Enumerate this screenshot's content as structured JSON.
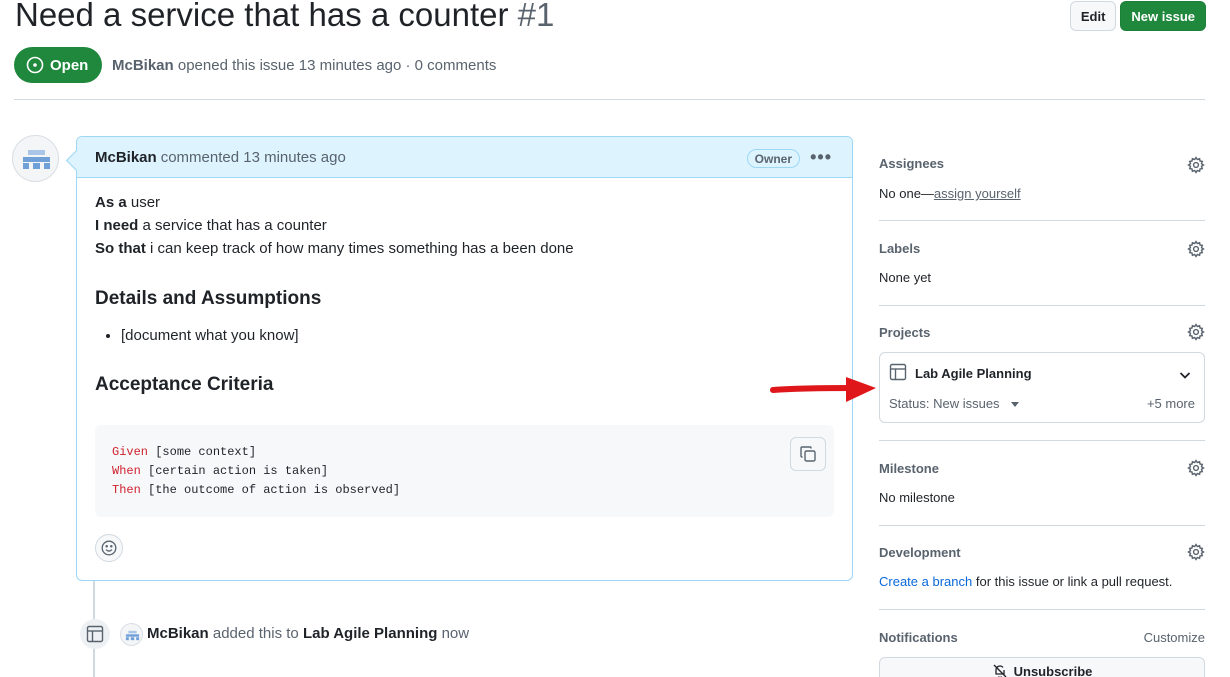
{
  "issue": {
    "title": "Need a service that has a counter",
    "number": "#1",
    "state": "Open",
    "author": "McBikan",
    "meta_rest": "opened this issue 13 minutes ago · 0 comments"
  },
  "header_buttons": {
    "edit": "Edit",
    "new_issue": "New issue"
  },
  "comment": {
    "author": "McBikan",
    "action": "commented 13 minutes ago",
    "badge": "Owner",
    "lines": [
      {
        "bold": "As a",
        "text": "user"
      },
      {
        "bold": "I need",
        "text": "a service that has a counter"
      },
      {
        "bold": "So that",
        "text": "i can keep track of how many times something has a been done"
      }
    ],
    "heading_details": "Details and Assumptions",
    "bullet": "[document what you know]",
    "heading_acceptance": "Acceptance Criteria",
    "code": [
      {
        "kw": "Given",
        "text": "[some context]"
      },
      {
        "kw": "When",
        "text": "[certain action is taken]"
      },
      {
        "kw": "Then",
        "text": "[the outcome of action is observed]"
      }
    ]
  },
  "timeline_event": {
    "actor": "McBikan",
    "action": "added this to",
    "target": "Lab Agile Planning",
    "time": "now"
  },
  "sidebar": {
    "assignees": {
      "label": "Assignees",
      "value_prefix": "No one—",
      "value_link": "assign yourself"
    },
    "labels": {
      "label": "Labels",
      "value": "None yet"
    },
    "projects": {
      "label": "Projects",
      "project_name": "Lab Agile Planning",
      "status": "Status: New issues",
      "more": "+5 more"
    },
    "milestone": {
      "label": "Milestone",
      "value": "No milestone"
    },
    "development": {
      "label": "Development",
      "link": "Create a branch",
      "rest": "for this issue or link a pull request."
    },
    "notifications": {
      "label": "Notifications",
      "customize": "Customize",
      "button": "Unsubscribe"
    }
  },
  "colors": {
    "open_green": "#1f883d",
    "comment_header_bg": "#ddf4ff",
    "comment_border": "#9cd7f5",
    "annotation_arrow": "#e0171a",
    "code_keyword": "#cf222e",
    "link_blue": "#0969da"
  }
}
